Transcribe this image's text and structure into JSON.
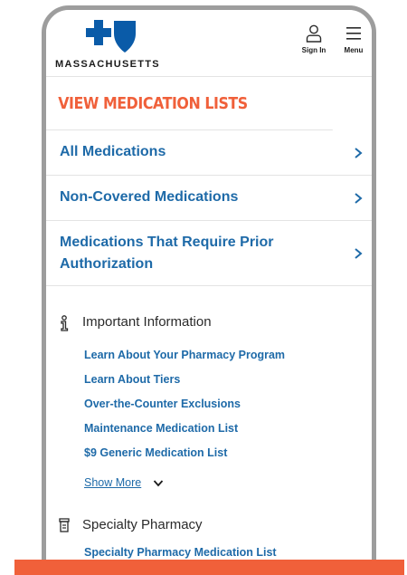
{
  "header": {
    "logo_text": "MASSACHUSETTS",
    "sign_in_label": "Sign In",
    "menu_label": "Menu",
    "sign_in_icon": "user-icon",
    "menu_icon": "hamburger-icon"
  },
  "colors": {
    "brand_blue": "#1e6aa8",
    "logo_blue": "#0a5ba8",
    "accent_orange": "#f0603a"
  },
  "main": {
    "section_title": "VIEW MEDICATION LISTS",
    "medication_lists": [
      {
        "label": "All Medications"
      },
      {
        "label": "Non-Covered Medications"
      },
      {
        "label": "Medications That Require Prior Authorization"
      }
    ],
    "important_info": {
      "heading": "Important Information",
      "icon": "info-icon",
      "links": [
        "Learn About Your Pharmacy Program",
        "Learn About Tiers",
        "Over-the-Counter Exclusions",
        "Maintenance Medication List",
        "$9 Generic Medication List"
      ],
      "show_more_label": "Show More"
    },
    "specialty_pharmacy": {
      "heading": "Specialty Pharmacy",
      "icon": "pill-bottle-icon",
      "links": [
        "Specialty Pharmacy Medication List"
      ]
    }
  }
}
